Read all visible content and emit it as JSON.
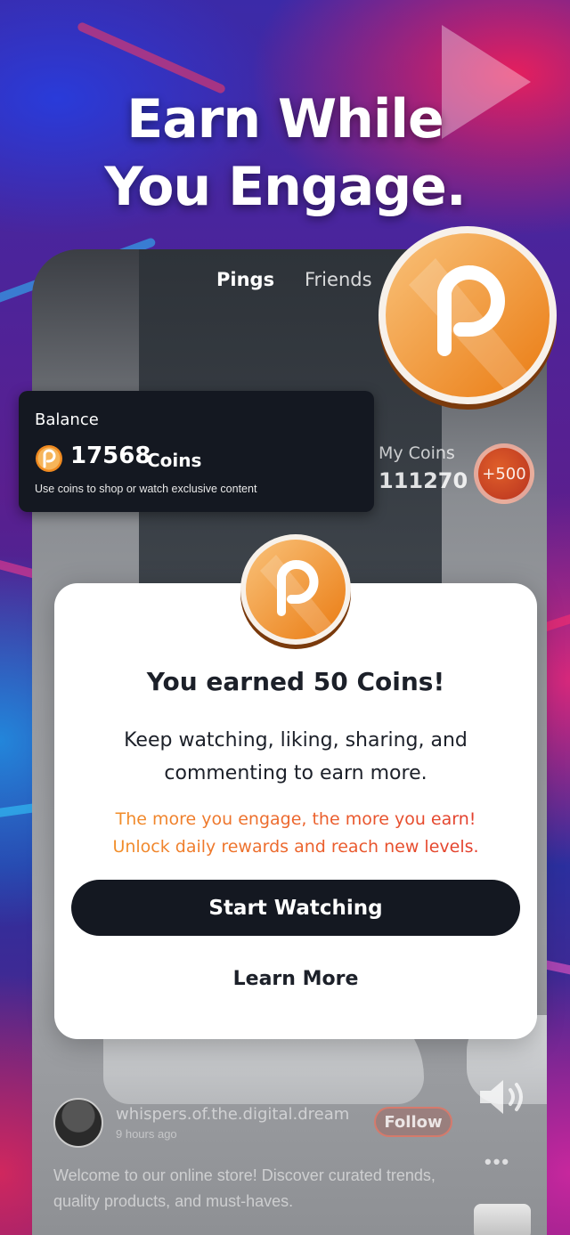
{
  "headline": {
    "line1": "Earn While",
    "line2": "You Engage."
  },
  "feed": {
    "tabs": [
      {
        "label": "Pings",
        "active": true
      },
      {
        "label": "Friends",
        "active": false
      }
    ],
    "my_coins": {
      "label": "My Coins",
      "value": "111270"
    },
    "reward_badge": "+500",
    "post": {
      "username": "whispers.of.the.digital.dream",
      "time": "9 hours ago",
      "follow_label": "Follow",
      "caption": "Welcome to our online store! Discover curated trends, quality products, and must-haves."
    }
  },
  "balance_card": {
    "label": "Balance",
    "amount": "17568",
    "unit": "Coins",
    "note": "Use coins to shop or watch exclusive content"
  },
  "modal": {
    "title": "You earned 50 Coins!",
    "body_line1": "Keep watching, liking, sharing, and",
    "body_line2": "commenting to earn more.",
    "promo_line1": "The more you engage, the more you earn!",
    "promo_line2": "Unlock daily rewards and reach new levels.",
    "primary_button": "Start Watching",
    "secondary_button": "Learn More"
  },
  "colors": {
    "coin_orange": "#f39a2a",
    "dark_button": "#141821",
    "promo_gradient_start": "#f39a2a",
    "promo_gradient_end": "#e0342e"
  },
  "icons": [
    "coin-logo-icon",
    "speaker-icon",
    "more-dots-icon"
  ]
}
